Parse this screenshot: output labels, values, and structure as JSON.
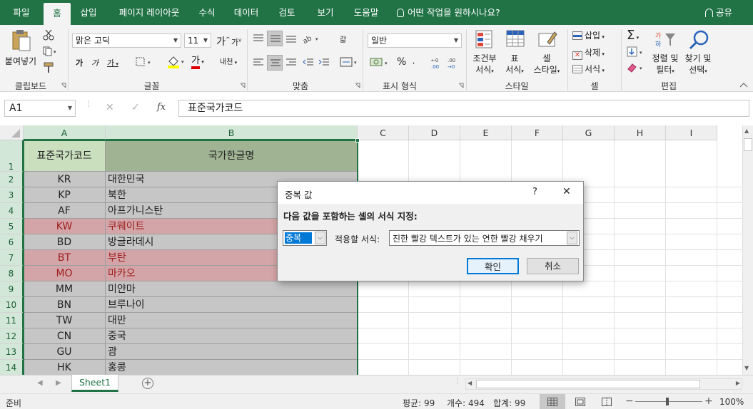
{
  "ribbon_tabs": [
    "파일",
    "홈",
    "삽입",
    "페이지 레이아웃",
    "수식",
    "데이터",
    "검토",
    "보기",
    "도움말"
  ],
  "active_tab": "홈",
  "tell_me": "어떤 작업을 원하시나요?",
  "share": "공유",
  "clipboard": {
    "paste": "붙여넣기",
    "group": "클립보드"
  },
  "font": {
    "name": "맑은 고딕",
    "size": "11",
    "group": "글꼴",
    "bold": "가",
    "italic": "가",
    "underline": "가",
    "grow": "가",
    "shrink": "가",
    "color_letter": "가",
    "phonetic": "내천"
  },
  "alignment": {
    "group": "맞춤",
    "wrap": "갋"
  },
  "number": {
    "format": "일반",
    "group": "표시 형식",
    "percent": "%"
  },
  "styles": {
    "conditional": "조건부\n서식",
    "conditional_1": "조건부",
    "conditional_2": "서식",
    "table_1": "표",
    "table_2": "서식",
    "cell_1": "셀",
    "cell_2": "스타일",
    "group": "스타일"
  },
  "cells": {
    "insert": "삽입",
    "delete": "삭제",
    "format": "서식",
    "group": "셀"
  },
  "editing": {
    "sort_1": "정렬 및",
    "sort_2": "필터",
    "find_1": "찾기 및",
    "find_2": "선택",
    "group": "편집"
  },
  "name_box": "A1",
  "formula_content": "표준국가코드",
  "fx": "fx",
  "columns": [
    "A",
    "B",
    "C",
    "D",
    "E",
    "F",
    "G",
    "H",
    "I"
  ],
  "header_row": {
    "a": "표준국가코드",
    "b": "국가한글명"
  },
  "rows": [
    {
      "n": "1"
    },
    {
      "n": "2",
      "a": "KR",
      "b": "대한민국",
      "dup": false
    },
    {
      "n": "3",
      "a": "KP",
      "b": "북한",
      "dup": false
    },
    {
      "n": "4",
      "a": "AF",
      "b": "아프가니스탄",
      "dup": false
    },
    {
      "n": "5",
      "a": "KW",
      "b": "쿠웨이트",
      "dup": true
    },
    {
      "n": "6",
      "a": "BD",
      "b": "방글라데시",
      "dup": false
    },
    {
      "n": "7",
      "a": "BT",
      "b": "부탄",
      "dup": true
    },
    {
      "n": "8",
      "a": "MO",
      "b": "마카오",
      "dup": true
    },
    {
      "n": "9",
      "a": "MM",
      "b": "미얀마",
      "dup": false
    },
    {
      "n": "10",
      "a": "BN",
      "b": "브루나이",
      "dup": false
    },
    {
      "n": "11",
      "a": "TW",
      "b": "대만",
      "dup": false
    },
    {
      "n": "12",
      "a": "CN",
      "b": "중국",
      "dup": false
    },
    {
      "n": "13",
      "a": "GU",
      "b": "괌",
      "dup": false
    },
    {
      "n": "14",
      "a": "HK",
      "b": "홍콩",
      "dup": false
    }
  ],
  "colors": {
    "accent": "#217346",
    "dup_fill": "#d4a5a8",
    "dup_text": "#9c1c1c",
    "selected_fill": "#c6c6c6",
    "header_fill": "#c9dfbe",
    "header_b_fill": "#a0b493"
  },
  "sheet_tab": "Sheet1",
  "status": {
    "ready": "준비",
    "avg": "평균: 99",
    "count": "개수: 494",
    "sum": "합계: 99",
    "zoom": "100%"
  },
  "dialog": {
    "title": "중복 값",
    "help": "?",
    "close": "✕",
    "instruction": "다음 값을 포함하는 셀의 서식 지정:",
    "type_value": "중복",
    "apply_label": "적용할 서식:",
    "format_value": "진한 빨강 텍스트가 있는 연한 빨강 채우기",
    "ok": "확인",
    "cancel": "취소"
  }
}
